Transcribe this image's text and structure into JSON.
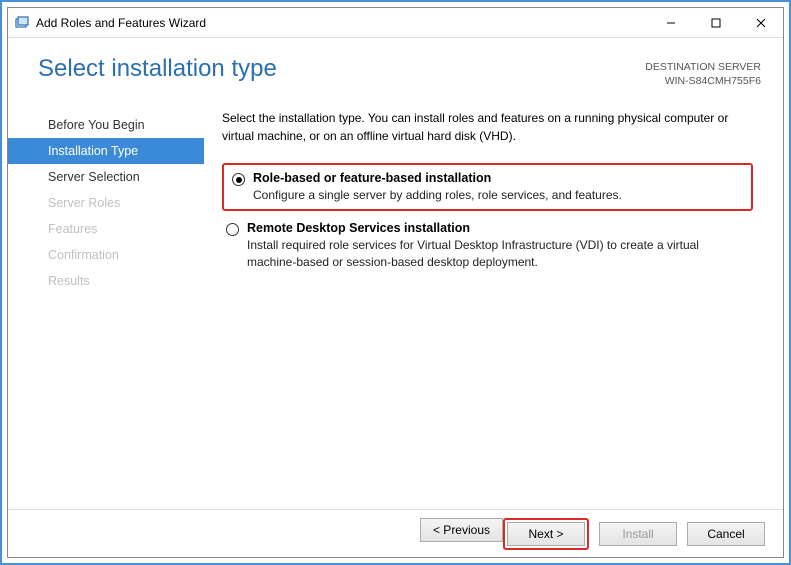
{
  "window": {
    "title": "Add Roles and Features Wizard"
  },
  "header": {
    "page_title": "Select installation type",
    "dest_label": "DESTINATION SERVER",
    "dest_value": "WIN-S84CMH755F6"
  },
  "sidebar": {
    "items": [
      {
        "label": "Before You Begin",
        "state": "normal"
      },
      {
        "label": "Installation Type",
        "state": "active"
      },
      {
        "label": "Server Selection",
        "state": "normal"
      },
      {
        "label": "Server Roles",
        "state": "disabled"
      },
      {
        "label": "Features",
        "state": "disabled"
      },
      {
        "label": "Confirmation",
        "state": "disabled"
      },
      {
        "label": "Results",
        "state": "disabled"
      }
    ]
  },
  "content": {
    "intro": "Select the installation type. You can install roles and features on a running physical computer or virtual machine, or on an offline virtual hard disk (VHD).",
    "options": [
      {
        "label": "Role-based or feature-based installation",
        "desc": "Configure a single server by adding roles, role services, and features.",
        "selected": true,
        "highlight": true
      },
      {
        "label": "Remote Desktop Services installation",
        "desc": "Install required role services for Virtual Desktop Infrastructure (VDI) to create a virtual machine-based or session-based desktop deployment.",
        "selected": false,
        "highlight": false
      }
    ]
  },
  "footer": {
    "previous": "< Previous",
    "next": "Next >",
    "install": "Install",
    "cancel": "Cancel"
  }
}
